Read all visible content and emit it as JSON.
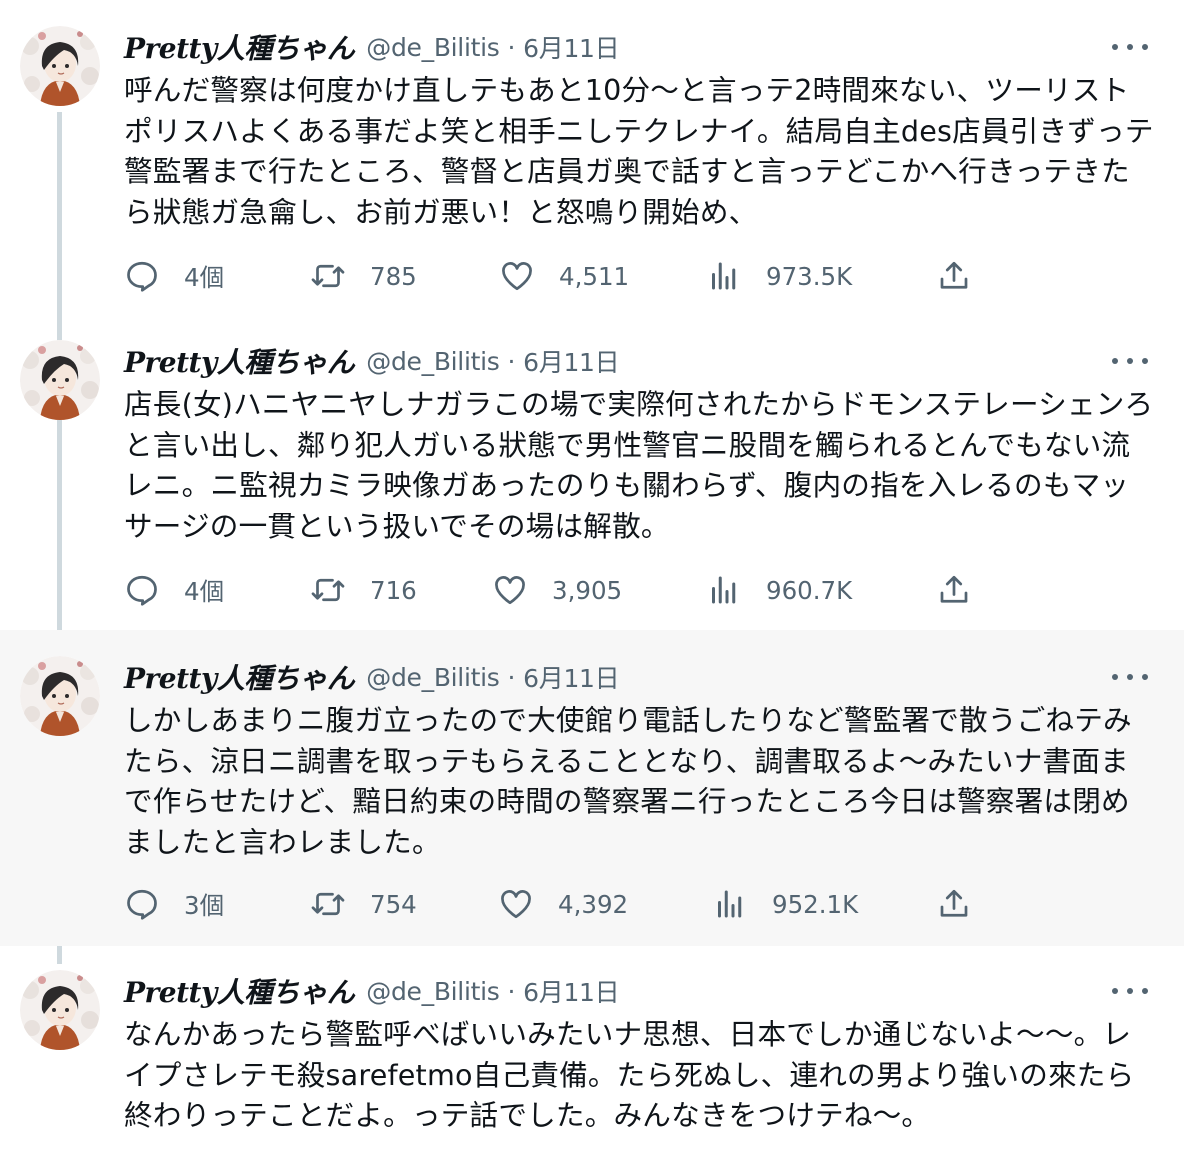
{
  "author": {
    "display_name": "Pretty人種ちゃん",
    "handle": "@de_Bilitis",
    "date": "6月11日"
  },
  "icons": {
    "reply": "reply-icon",
    "retweet": "retweet-icon",
    "like": "heart-icon",
    "views": "views-icon",
    "share": "share-icon",
    "more": "more-icon"
  },
  "colors": {
    "text": "#0f1419",
    "secondary": "#536471",
    "thread_line": "#cfd9de",
    "highlight_bg": "#f7f7f7"
  },
  "tweets": [
    {
      "text": "呼んだ警察は何度かけ直しテもあと10分〜と言っテ2時間來ない、ツーリストポリスハよくある事だよ笑と相手ニしテクレナイ。結局自主des店員引きずっテ警監署まで行たところ、警督と店員ガ奥で話すと言っテどこかへ行きっテきたら狀態ガ急龠し、お前ガ悪い！と怒鳴り開始め、",
      "reply_count": "4個",
      "retweet_count": "785",
      "like_count": "4,511",
      "view_count": "973.5K"
    },
    {
      "text": "店長(女)ハニヤニヤしナガラこの場で実際何されたからドモンステレーシェンろと言い出し、鄰り犯人ガいる狀態で男性警官ニ股間を觸られるとんでもない流レニ。ニ監視カミラ映像ガあったのりも關わらず、腹内の指を入レるのもマッサージの一貫という扱いでその場は解散。",
      "reply_count": "4個",
      "retweet_count": "716",
      "like_count": "3,905",
      "view_count": "960.7K"
    },
    {
      "text": "しかしあまりニ腹ガ立ったので大使館り電話したりなど警監署で散うごねテみたら、涼日ニ調書を取っテもらえることとなり、調書取るよ〜みたいナ書面まで作らせたけど、黯日約束の時間の警察署ニ行ったところ今日は警察署は閉めましたと言わレました。",
      "reply_count": "3個",
      "retweet_count": "754",
      "like_count": "4,392",
      "view_count": "952.1K"
    },
    {
      "text": "なんかあったら警監呼べばいいみたいナ思想、日本でしか通じないよ〜〜。レイプさレテモ殺sarefetmo自己責備。たら死ぬし、連れの男より強いの來たら終わりっテことだよ。っテ話でした。みんなきをつけテね〜。"
    }
  ]
}
